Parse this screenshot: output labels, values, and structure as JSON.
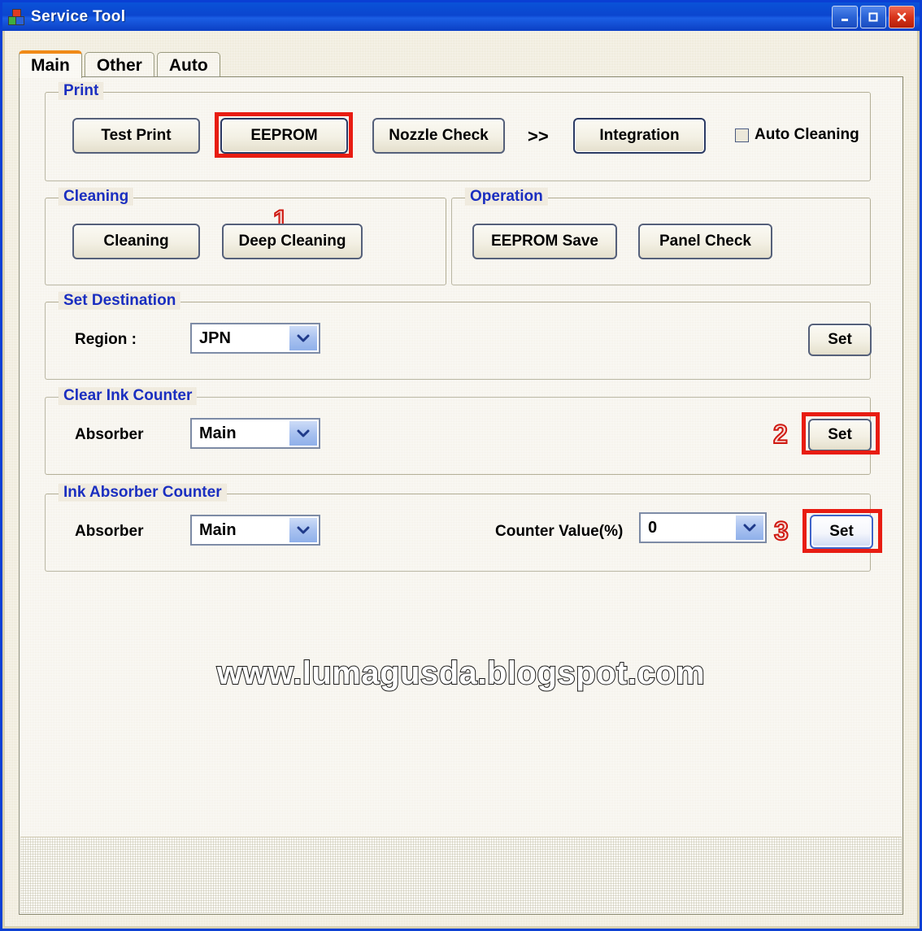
{
  "window": {
    "title": "Service Tool",
    "icon": "app-blocks-icon",
    "controls": {
      "minimize": "minimize-icon",
      "maximize": "maximize-icon",
      "close": "close-icon"
    }
  },
  "tabs": [
    {
      "label": "Main",
      "active": true
    },
    {
      "label": "Other",
      "active": false
    },
    {
      "label": "Auto",
      "active": false
    }
  ],
  "groups": {
    "print": {
      "label": "Print",
      "buttons": [
        {
          "label": "Test Print"
        },
        {
          "label": "EEPROM"
        },
        {
          "label": "Nozzle Check"
        },
        {
          "label": "Integration"
        }
      ],
      "separator": ">>",
      "checkbox": {
        "label": "Auto Cleaning",
        "checked": false
      }
    },
    "cleaning": {
      "label": "Cleaning",
      "buttons": [
        {
          "label": "Cleaning"
        },
        {
          "label": "Deep Cleaning"
        }
      ]
    },
    "operation": {
      "label": "Operation",
      "buttons": [
        {
          "label": "EEPROM Save"
        },
        {
          "label": "Panel Check"
        }
      ]
    },
    "set_destination": {
      "label": "Set Destination",
      "field_label": "Region :",
      "region_value": "JPN",
      "set_label": "Set"
    },
    "clear_ink_counter": {
      "label": "Clear Ink Counter",
      "field_label": "Absorber",
      "absorber_value": "Main",
      "set_label": "Set"
    },
    "ink_absorber_counter": {
      "label": "Ink Absorber Counter",
      "field_label": "Absorber",
      "absorber_value": "Main",
      "counter_label": "Counter Value(%)",
      "counter_value": "0",
      "set_label": "Set"
    }
  },
  "annotations": [
    {
      "number": "1",
      "target": "eeprom-button"
    },
    {
      "number": "2",
      "target": "clear-ink-counter-set-button"
    },
    {
      "number": "3",
      "target": "ink-absorber-counter-set-button"
    }
  ],
  "watermark": "www.lumagusda.blogspot.com",
  "colors": {
    "titlebar": "#0b46cf",
    "group_label": "#1a2ec0",
    "highlight": "#e81c12",
    "active_tab_accent": "#f08a18",
    "client_bg": "#e6e0c8"
  }
}
